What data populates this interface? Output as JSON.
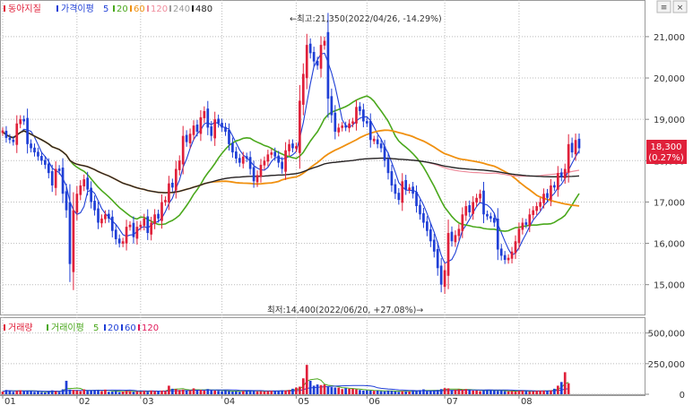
{
  "stock_name": "동아지질",
  "price_legend": {
    "label": "가격이평",
    "items": [
      {
        "text": "5",
        "color": "#1f3fd6"
      },
      {
        "text": "20",
        "color": "#4aa81c"
      },
      {
        "text": "60",
        "color": "#f0900f"
      },
      {
        "text": "120",
        "color": "#ef8c9c"
      },
      {
        "text": "240",
        "color": "#9a9a9a"
      },
      {
        "text": "480",
        "color": "#222222"
      }
    ]
  },
  "volume_legend": {
    "label": "거래량",
    "ma_label": "거래이평",
    "items": [
      {
        "text": "5",
        "color": "#4aa81c"
      },
      {
        "text": "20",
        "color": "#1f3fd6"
      },
      {
        "text": "60",
        "color": "#1f3fd6"
      },
      {
        "text": "120",
        "color": "#e0195a"
      }
    ]
  },
  "annotations": {
    "high": "←최고:21,350(2022/04/26, -14.29%)",
    "low": "최저:14,400(2022/06/20, +27.08%)→"
  },
  "current_price": {
    "value": "18,300",
    "change": "(0.27%)",
    "color": "#e0203a"
  },
  "colors": {
    "up": "#e0203a",
    "down": "#1f3fd6"
  },
  "chart_data": {
    "type": "candlestick",
    "x_tick_labels": [
      "01",
      "02",
      "03",
      "04",
      "05",
      "06",
      "07",
      "08"
    ],
    "price_axis": {
      "ticks": [
        15000,
        16000,
        17000,
        18000,
        19000,
        20000,
        21000
      ],
      "tick_labels": [
        "15,000",
        "16,000",
        "17,000",
        "18,000",
        "19,000",
        "20,000",
        "21,000"
      ],
      "ylim": [
        14300,
        21800
      ]
    },
    "volume_axis": {
      "ticks": [
        0,
        250000,
        500000
      ],
      "tick_labels": [
        "0",
        "250,000",
        "500,000"
      ],
      "ylim": [
        0,
        600000
      ]
    },
    "month_start_index": [
      0,
      21,
      39,
      62,
      83,
      103,
      125,
      146
    ],
    "close": [
      18700,
      18550,
      18500,
      18450,
      18900,
      19000,
      18950,
      18400,
      18300,
      18200,
      18100,
      18000,
      17900,
      17700,
      17400,
      17800,
      17750,
      17200,
      16800,
      15500,
      16800,
      17200,
      17400,
      17550,
      17300,
      17000,
      16800,
      16500,
      16600,
      16700,
      16600,
      16300,
      16100,
      16000,
      16050,
      16400,
      16450,
      16150,
      16400,
      16450,
      16600,
      16250,
      16500,
      16700,
      16600,
      17000,
      17050,
      17450,
      17350,
      17800,
      18000,
      18600,
      18450,
      18650,
      18850,
      18700,
      19050,
      19200,
      18800,
      18600,
      19000,
      18900,
      18800,
      18700,
      18400,
      18200,
      18050,
      17950,
      18100,
      18050,
      17800,
      17500,
      17650,
      17900,
      18000,
      18150,
      18200,
      18100,
      17950,
      17800,
      18250,
      18400,
      18300,
      18350,
      19450,
      20100,
      20800,
      20600,
      20400,
      20300,
      20800,
      20900,
      19500,
      19100,
      18700,
      18800,
      18850,
      18800,
      18900,
      18950,
      19300,
      19200,
      18950,
      18900,
      18500,
      18500,
      18400,
      18300,
      18000,
      17700,
      17400,
      17200,
      17050,
      17500,
      17300,
      17350,
      17200,
      16900,
      16700,
      16500,
      16300,
      16050,
      15800,
      15400,
      15000,
      15350,
      16250,
      16050,
      16200,
      16350,
      16700,
      16900,
      16750,
      17000,
      17100,
      17200,
      16700,
      16650,
      16600,
      16500,
      15850,
      15700,
      15600,
      15650,
      15800,
      16050,
      16350,
      16500,
      16450,
      16700,
      16800,
      16900,
      17000,
      17200,
      17100,
      17400,
      17350,
      17700,
      17600,
      17800,
      18400,
      18200,
      18500,
      18300
    ],
    "volume": [
      22000,
      35000,
      30000,
      20000,
      28000,
      33000,
      25000,
      30000,
      26000,
      20000,
      22000,
      18000,
      15000,
      24000,
      32000,
      25000,
      20000,
      40000,
      110000,
      38000,
      35000,
      30000,
      25000,
      40000,
      28000,
      30000,
      35000,
      34000,
      25000,
      38000,
      20000,
      22000,
      26000,
      18000,
      22000,
      28000,
      26000,
      20000,
      24000,
      22000,
      28000,
      20000,
      30000,
      26000,
      25000,
      30000,
      27000,
      70000,
      45000,
      42000,
      35000,
      38000,
      30000,
      32000,
      48000,
      35000,
      36000,
      30000,
      42000,
      33000,
      30000,
      28000,
      25000,
      30000,
      26000,
      22000,
      24000,
      20000,
      26000,
      32000,
      28000,
      30000,
      24000,
      25000,
      22000,
      26000,
      28000,
      26000,
      30000,
      33000,
      31000,
      35000,
      45000,
      55000,
      62000,
      130000,
      240000,
      110000,
      70000,
      80000,
      75000,
      80000,
      60000,
      58000,
      55000,
      54000,
      42000,
      50000,
      45000,
      44000,
      40000,
      35000,
      30000,
      32000,
      30000,
      28000,
      30000,
      25000,
      24000,
      30000,
      28000,
      22000,
      20000,
      25000,
      24000,
      22000,
      28000,
      30000,
      34000,
      40000,
      25000,
      30000,
      32000,
      35000,
      42000,
      50000,
      48000,
      35000,
      37000,
      40000,
      38000,
      42000,
      34000,
      30000,
      30000,
      25000,
      30000,
      35000,
      32000,
      30000,
      28000,
      30000,
      25000,
      24000,
      26000,
      22000,
      28000,
      30000,
      25000,
      22000,
      24000,
      28000,
      30000,
      30000,
      28000,
      32000,
      45000,
      70000,
      100000,
      180000,
      90000
    ]
  }
}
